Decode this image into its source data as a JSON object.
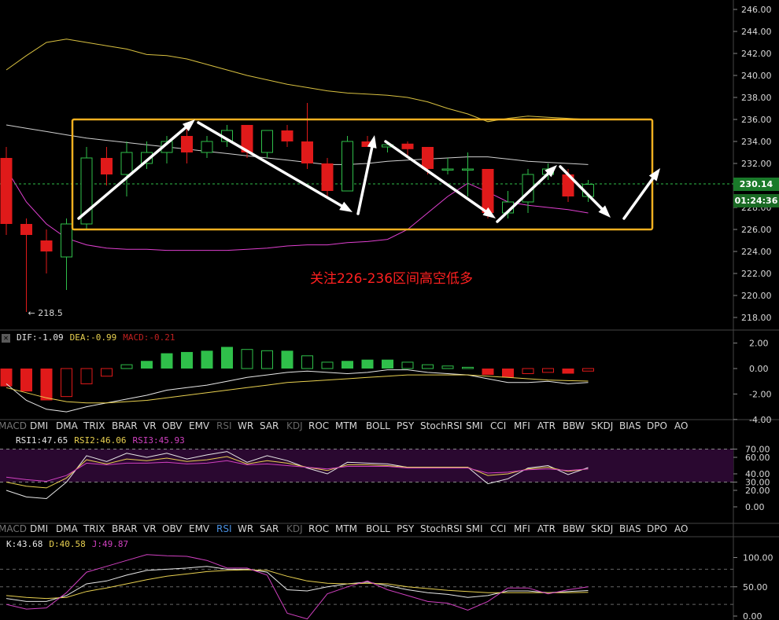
{
  "main_panel": {
    "y_ticks": [
      "246.00",
      "244.00",
      "242.00",
      "240.00",
      "238.00",
      "236.00",
      "234.00",
      "232.00",
      "230.00",
      "228.00",
      "226.00",
      "224.00",
      "222.00",
      "220.00",
      "218.00"
    ],
    "last_price": "230.14",
    "countdown": "01:24:36",
    "low_label": "← 218.5",
    "annotation": "关注226-236区间高空低多",
    "box_range": [
      226,
      236
    ],
    "colors": {
      "up": "#2fbf4a",
      "down": "#e01a1a",
      "upper_band": "#d8c040",
      "mid_band": "#d0d0d0",
      "lower_band": "#e040d0",
      "box": "#f0b020",
      "arrow": "#ffffff"
    }
  },
  "macd_panel": {
    "header": {
      "dif": "DIF:-1.09",
      "dea": "DEA:-0.99",
      "macd": "MACD:-0.21"
    },
    "y_ticks": [
      "2.00",
      "0.00",
      "-2.00",
      "-4.00"
    ],
    "close_glyph": "✕"
  },
  "tabs_row_1": [
    "MACD",
    "DMI",
    "DMA",
    "TRIX",
    "BRAR",
    "VR",
    "OBV",
    "EMV",
    "RSI",
    "WR",
    "SAR",
    "KDJ",
    "ROC",
    "MTM",
    "BOLL",
    "PSY",
    "StochRSI",
    "SMI",
    "CCI",
    "MFI",
    "ATR",
    "BBW",
    "SKDJ",
    "BIAS",
    "DPO",
    "AO"
  ],
  "rsi_panel": {
    "header": {
      "rsi1": "RSI1:47.65",
      "rsi2": "RSI2:46.06",
      "rsi3": "RSI3:45.93"
    },
    "y_ticks": [
      "70.00",
      "60.00",
      "40.00",
      "30.00",
      "20.00",
      "0.00"
    ]
  },
  "tabs_row_2": [
    "MACD",
    "DMI",
    "DMA",
    "TRIX",
    "BRAR",
    "VR",
    "OBV",
    "EMV",
    "RSI",
    "WR",
    "SAR",
    "KDJ",
    "ROC",
    "MTM",
    "BOLL",
    "PSY",
    "StochRSI",
    "SMI",
    "CCI",
    "MFI",
    "ATR",
    "BBW",
    "SKDJ",
    "BIAS",
    "DPO",
    "AO"
  ],
  "kdj_panel": {
    "header": {
      "k": "K:43.68",
      "d": "D:40.58",
      "j": "J:49.87"
    },
    "y_ticks": [
      "100.00",
      "50.00",
      "0.00"
    ]
  },
  "chart_data": {
    "type": "candlestick",
    "y_range": [
      217,
      246.5
    ],
    "candles": [
      {
        "o": 232.5,
        "h": 233.5,
        "l": 225.5,
        "c": 226.5
      },
      {
        "o": 226.5,
        "h": 227.0,
        "l": 218.5,
        "c": 225.5
      },
      {
        "o": 225.0,
        "h": 226.0,
        "l": 222.0,
        "c": 224.0
      },
      {
        "o": 223.5,
        "h": 227.0,
        "l": 220.5,
        "c": 226.5
      },
      {
        "o": 226.5,
        "h": 233.5,
        "l": 226.0,
        "c": 232.5
      },
      {
        "o": 232.5,
        "h": 233.5,
        "l": 230.0,
        "c": 231.0
      },
      {
        "o": 231.0,
        "h": 234.0,
        "l": 229.0,
        "c": 233.0
      },
      {
        "o": 232.0,
        "h": 234.0,
        "l": 231.5,
        "c": 233.0
      },
      {
        "o": 233.0,
        "h": 234.5,
        "l": 232.0,
        "c": 234.0
      },
      {
        "o": 234.5,
        "h": 235.5,
        "l": 232.0,
        "c": 233.0
      },
      {
        "o": 233.0,
        "h": 234.5,
        "l": 232.5,
        "c": 234.0
      },
      {
        "o": 234.0,
        "h": 235.5,
        "l": 233.5,
        "c": 235.0
      },
      {
        "o": 235.5,
        "h": 235.5,
        "l": 232.5,
        "c": 233.0
      },
      {
        "o": 233.0,
        "h": 235.0,
        "l": 232.5,
        "c": 235.0
      },
      {
        "o": 235.0,
        "h": 235.5,
        "l": 233.5,
        "c": 234.0
      },
      {
        "o": 234.0,
        "h": 237.5,
        "l": 231.5,
        "c": 232.0
      },
      {
        "o": 232.0,
        "h": 232.5,
        "l": 229.0,
        "c": 229.5
      },
      {
        "o": 229.5,
        "h": 234.5,
        "l": 229.5,
        "c": 234.0
      },
      {
        "o": 234.0,
        "h": 234.5,
        "l": 233.5,
        "c": 233.5
      },
      {
        "o": 233.5,
        "h": 234.0,
        "l": 233.0,
        "c": 233.7
      },
      {
        "o": 233.8,
        "h": 234.0,
        "l": 232.5,
        "c": 233.3
      },
      {
        "o": 233.5,
        "h": 233.5,
        "l": 231.0,
        "c": 231.5
      },
      {
        "o": 231.5,
        "h": 232.5,
        "l": 231.0,
        "c": 231.5
      },
      {
        "o": 231.5,
        "h": 233.0,
        "l": 229.0,
        "c": 231.5
      },
      {
        "o": 231.5,
        "h": 231.5,
        "l": 227.0,
        "c": 227.5
      },
      {
        "o": 227.5,
        "h": 229.5,
        "l": 227.0,
        "c": 228.5
      },
      {
        "o": 228.5,
        "h": 231.5,
        "l": 227.5,
        "c": 231.0
      },
      {
        "o": 231.0,
        "h": 232.0,
        "l": 230.5,
        "c": 231.5
      },
      {
        "o": 231.0,
        "h": 231.5,
        "l": 228.5,
        "c": 229.0
      },
      {
        "o": 229.0,
        "h": 230.5,
        "l": 228.5,
        "c": 230.1
      }
    ],
    "upper_band": [
      240.5,
      241.8,
      243.0,
      243.3,
      243.0,
      242.7,
      242.4,
      241.9,
      241.8,
      241.5,
      241.0,
      240.5,
      240.0,
      239.6,
      239.2,
      238.9,
      238.6,
      238.4,
      238.3,
      238.2,
      238.0,
      237.6,
      237.0,
      236.5,
      235.8,
      236.1,
      236.3,
      236.2,
      236.1,
      236.0
    ],
    "mid_band": [
      235.5,
      235.2,
      234.9,
      234.6,
      234.3,
      234.1,
      233.9,
      233.7,
      233.5,
      233.3,
      233.1,
      232.9,
      232.7,
      232.5,
      232.3,
      232.1,
      231.9,
      231.9,
      232.0,
      232.2,
      232.3,
      232.4,
      232.5,
      232.6,
      232.6,
      232.4,
      232.2,
      232.1,
      232.0,
      231.9
    ],
    "lower_band": [
      231.5,
      228.5,
      226.5,
      225.2,
      224.6,
      224.3,
      224.2,
      224.2,
      224.1,
      224.1,
      224.1,
      224.1,
      224.2,
      224.3,
      224.5,
      224.6,
      224.6,
      224.8,
      224.9,
      225.1,
      226.0,
      227.5,
      229.0,
      230.2,
      229.4,
      228.5,
      228.2,
      228.0,
      227.8,
      227.5
    ],
    "macd_hist": [
      -1.4,
      -1.8,
      -2.5,
      -2.2,
      -1.2,
      -0.6,
      0.3,
      0.6,
      1.2,
      1.3,
      1.4,
      1.7,
      1.5,
      1.4,
      1.4,
      1.0,
      0.5,
      0.6,
      0.7,
      0.7,
      0.5,
      0.3,
      0.2,
      0.1,
      -0.5,
      -0.7,
      -0.4,
      -0.3,
      -0.4,
      -0.2
    ],
    "dif": [
      -1.2,
      -2.5,
      -3.2,
      -3.4,
      -3.0,
      -2.7,
      -2.4,
      -2.1,
      -1.7,
      -1.5,
      -1.3,
      -1.0,
      -0.7,
      -0.5,
      -0.3,
      -0.2,
      -0.3,
      -0.4,
      -0.3,
      -0.1,
      -0.1,
      -0.3,
      -0.4,
      -0.5,
      -0.8,
      -1.1,
      -1.1,
      -1.0,
      -1.2,
      -1.09
    ],
    "dea": [
      -1.5,
      -1.9,
      -2.3,
      -2.6,
      -2.7,
      -2.7,
      -2.6,
      -2.5,
      -2.3,
      -2.1,
      -1.9,
      -1.7,
      -1.5,
      -1.3,
      -1.1,
      -1.0,
      -0.9,
      -0.8,
      -0.7,
      -0.6,
      -0.5,
      -0.5,
      -0.5,
      -0.5,
      -0.6,
      -0.7,
      -0.8,
      -0.9,
      -0.95,
      -0.99
    ],
    "rsi1": [
      20,
      12,
      10,
      30,
      62,
      55,
      65,
      60,
      65,
      58,
      63,
      67,
      54,
      62,
      56,
      47,
      40,
      54,
      53,
      52,
      48,
      48,
      48,
      48,
      28,
      34,
      47,
      50,
      39,
      47.65
    ],
    "rsi2": [
      30,
      25,
      23,
      35,
      57,
      52,
      58,
      56,
      59,
      55,
      57,
      61,
      52,
      56,
      53,
      48,
      44,
      51,
      51,
      50,
      48,
      48,
      48,
      48,
      38,
      40,
      46,
      48,
      43,
      46.06
    ],
    "rsi3": [
      36,
      33,
      31,
      38,
      53,
      51,
      53,
      53,
      54,
      52,
      53,
      56,
      51,
      52,
      50,
      48,
      46,
      49,
      49,
      49,
      47,
      47,
      47,
      47,
      41,
      42,
      45,
      46,
      44,
      45.93
    ],
    "k": [
      30,
      25,
      25,
      35,
      55,
      60,
      70,
      78,
      80,
      82,
      85,
      80,
      80,
      75,
      45,
      43,
      50,
      55,
      58,
      52,
      45,
      40,
      37,
      32,
      35,
      43,
      43,
      40,
      42,
      43.68
    ],
    "d": [
      35,
      32,
      30,
      32,
      42,
      48,
      55,
      62,
      68,
      72,
      76,
      78,
      79,
      78,
      68,
      60,
      56,
      55,
      56,
      55,
      50,
      47,
      44,
      42,
      40,
      40,
      40,
      40,
      40,
      40.58
    ],
    "j": [
      20,
      12,
      14,
      40,
      75,
      85,
      95,
      105,
      103,
      102,
      95,
      82,
      82,
      70,
      5,
      -5,
      38,
      50,
      60,
      45,
      35,
      25,
      22,
      10,
      25,
      48,
      48,
      38,
      45,
      49.87
    ]
  }
}
